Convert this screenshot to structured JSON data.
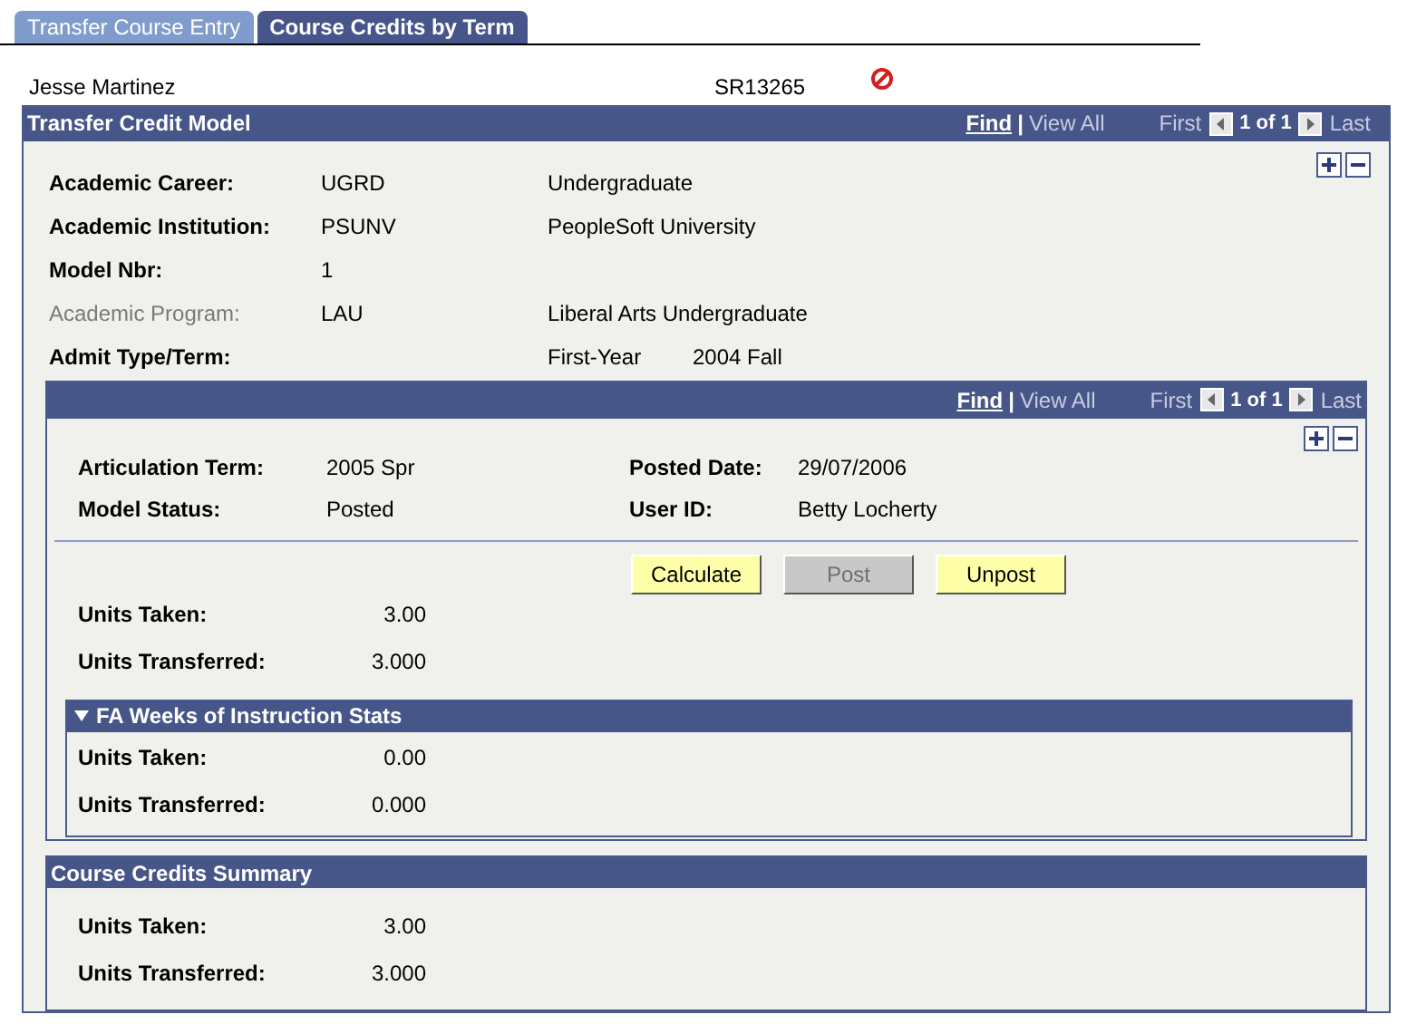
{
  "tabs": [
    {
      "label": "Transfer Course Entry",
      "selected": false
    },
    {
      "label": "Course Credits by Term",
      "selected": true
    }
  ],
  "student": {
    "name": "Jesse Martinez",
    "id": "SR13265"
  },
  "model": {
    "title": "Transfer Credit Model",
    "nav": {
      "find": "Find",
      "separator": "|",
      "view_all": "View All",
      "first": "First",
      "count": "1 of 1",
      "last": "Last"
    },
    "fields": [
      {
        "label": "Academic Career:",
        "value": "UGRD",
        "description": "Undergraduate",
        "disabled": false
      },
      {
        "label": "Academic Institution:",
        "value": "PSUNV",
        "description": "PeopleSoft University",
        "disabled": false
      },
      {
        "label": "Model Nbr:",
        "value": "1",
        "disabled": false
      },
      {
        "label": "Academic Program:",
        "value": "LAU",
        "description": "Liberal Arts Undergraduate",
        "disabled": true
      },
      {
        "label": "Admit Type/Term:",
        "description": "First-Year",
        "term": "2004 Fall",
        "disabled": false
      }
    ],
    "articulation": {
      "nav": {
        "find": "Find",
        "separator": "|",
        "view_all": "View All",
        "first": "First",
        "count": "1 of 1",
        "last": "Last"
      },
      "fields": [
        {
          "label": "Articulation Term:",
          "value": "2005 Spr"
        },
        {
          "label": "Posted Date:",
          "value": "29/07/2006"
        },
        {
          "label": "Model Status:",
          "value": "Posted"
        },
        {
          "label": "User ID:",
          "value": "Betty Locherty"
        }
      ],
      "buttons": [
        {
          "label": "Calculate",
          "disabled": false
        },
        {
          "label": "Post",
          "disabled": true
        },
        {
          "label": "Unpost",
          "disabled": false
        }
      ],
      "units": [
        {
          "label": "Units Taken:",
          "value": "3.00"
        },
        {
          "label": "Units Transferred:",
          "value": "3.000"
        }
      ],
      "fa_section": {
        "title": "FA Weeks of Instruction Stats",
        "expanded": true,
        "units": [
          {
            "label": "Units Taken:",
            "value": "0.00"
          },
          {
            "label": "Units Transferred:",
            "value": "0.000"
          }
        ]
      }
    }
  },
  "summary": {
    "title": "Course Credits Summary",
    "units": [
      {
        "label": "Units Taken:",
        "value": "3.00"
      },
      {
        "label": "Units Transferred:",
        "value": "3.000"
      }
    ]
  }
}
